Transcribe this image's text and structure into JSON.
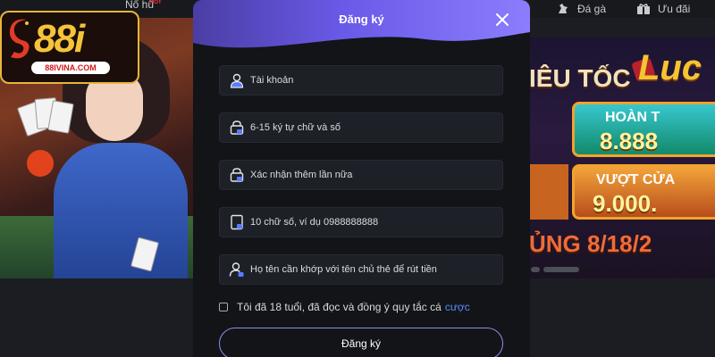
{
  "nav": {
    "no_hu": "Nổ hũ",
    "no_hu_badge": "HOT",
    "da_ga": "Đá gà",
    "uu_dai": "Ưu đãi"
  },
  "logo": {
    "text": "88i",
    "url": "88IVINA.COM"
  },
  "promo": {
    "title": "IÊU TỐC",
    "brand": "Luc",
    "panel1_label": "HOÀN T",
    "panel1_value": "8.888",
    "panel2_label": "VƯỢT CỬA",
    "panel2_value": "9.000.",
    "date_text": "ỦNG 8/18/2"
  },
  "modal": {
    "title": "Đăng ký",
    "fields": [
      {
        "placeholder": "Tài khoản",
        "icon": "user-icon"
      },
      {
        "placeholder": "6-15 ký tự chữ và số",
        "icon": "lock-icon"
      },
      {
        "placeholder": "Xác nhận thêm lần nữa",
        "icon": "lock-icon"
      },
      {
        "placeholder": "10 chữ số, ví dụ 0988888888",
        "icon": "phone-icon"
      },
      {
        "placeholder": "Họ tên cần khớp với tên chủ thẻ để rút tiền",
        "icon": "user-add-icon"
      }
    ],
    "agree_text": "Tôi đã 18 tuổi, đã đọc và đồng ý quy tắc cá",
    "agree_link": "cược",
    "submit_label": "Đăng ký"
  },
  "colors": {
    "header_gradient_start": "#4a3ea4",
    "header_gradient_end": "#8b7dfd",
    "link": "#5b8bff",
    "modal_bg": "#121418",
    "field_bg": "#1d2026"
  }
}
